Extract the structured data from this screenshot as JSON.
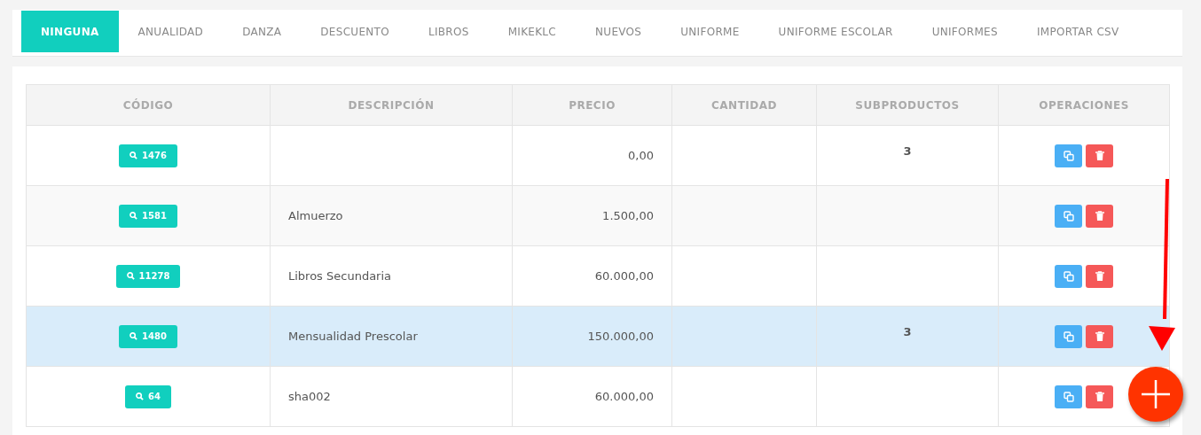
{
  "tabs": [
    {
      "label": "NINGUNA",
      "selected": true
    },
    {
      "label": "ANUALIDAD",
      "selected": false
    },
    {
      "label": "DANZA",
      "selected": false
    },
    {
      "label": "DESCUENTO",
      "selected": false
    },
    {
      "label": "LIBROS",
      "selected": false
    },
    {
      "label": "MIKEKLC",
      "selected": false
    },
    {
      "label": "NUEVOS",
      "selected": false
    },
    {
      "label": "UNIFORME",
      "selected": false
    },
    {
      "label": "UNIFORME ESCOLAR",
      "selected": false
    },
    {
      "label": "UNIFORMES",
      "selected": false
    },
    {
      "label": "IMPORTAR CSV",
      "selected": false
    }
  ],
  "table": {
    "columns": [
      "CÓDIGO",
      "DESCRIPCIÓN",
      "PRECIO",
      "CANTIDAD",
      "SUBPRODUCTOS",
      "OPERACIONES"
    ],
    "rows": [
      {
        "code": "1476",
        "price": "0,00",
        "subproducts": "3",
        "selected": false
      },
      {
        "code": "1581",
        "description": "Almuerzo",
        "price": "1.500,00",
        "selected": false
      },
      {
        "code": "11278",
        "description": "Libros Secundaria",
        "price": "60.000,00",
        "selected": false
      },
      {
        "code": "1480",
        "description": "Mensualidad Prescolar",
        "price": "150.000,00",
        "subproducts": "3",
        "selected": true
      },
      {
        "code": "64",
        "description": "sha002",
        "price": "60.000,00",
        "selected": false
      }
    ]
  }
}
